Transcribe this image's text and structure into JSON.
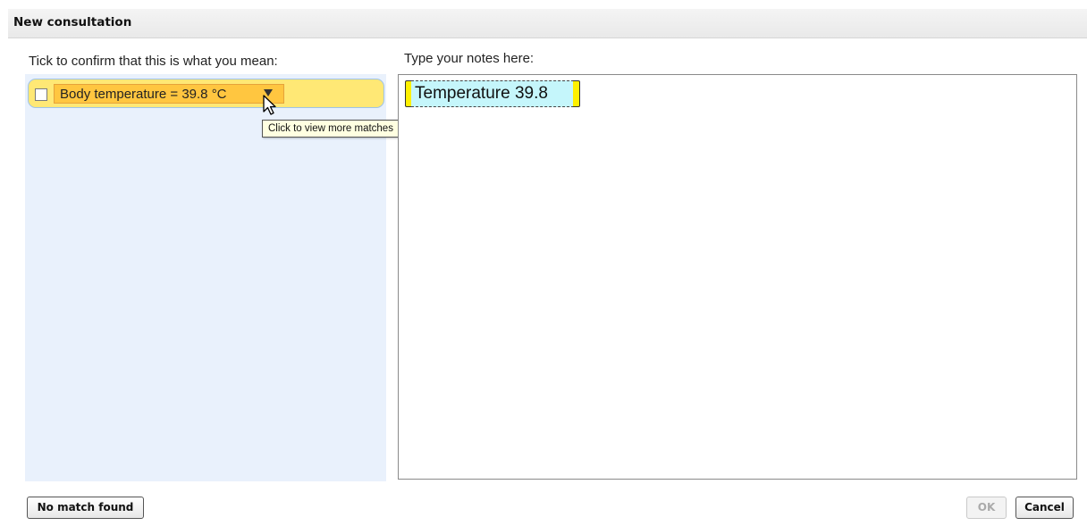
{
  "dialog": {
    "title": "New consultation"
  },
  "left": {
    "label": "Tick to confirm that this is what you mean:",
    "items": [
      {
        "term": "Body temperature = 39.8 °C",
        "checked": false
      }
    ],
    "tooltip": "Click to view more matches"
  },
  "right": {
    "label": "Type your notes here:",
    "note_text": "Temperature 39.8"
  },
  "buttons": {
    "no_match": "No match found",
    "ok": "OK",
    "cancel": "Cancel"
  },
  "colors": {
    "match_highlight": "#ffe875",
    "term_highlight": "#ffc640",
    "note_token_fill": "#c5f6fb",
    "note_token_bracket": "#fff000",
    "left_panel_bg": "#e9f1fc"
  }
}
